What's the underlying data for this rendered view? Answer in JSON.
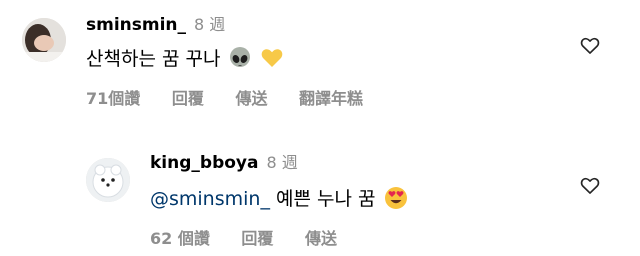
{
  "comments": [
    {
      "username": "sminsmin_",
      "time": "8 週",
      "text": "산책하는 꿈 꾸나",
      "emojis": [
        "alien-emoji",
        "yellow-heart-emoji"
      ],
      "likes": "71個讚",
      "reply": "回覆",
      "share": "傳送",
      "translate": "翻譯年糕"
    },
    {
      "username": "king_bboya",
      "time": "8 週",
      "mention": "@sminsmin_",
      "text": " 예쁜 누나 꿈",
      "emojis": [
        "heart-eyes-emoji"
      ],
      "likes": "62 個讚",
      "reply": "回覆",
      "share": "傳送"
    }
  ]
}
